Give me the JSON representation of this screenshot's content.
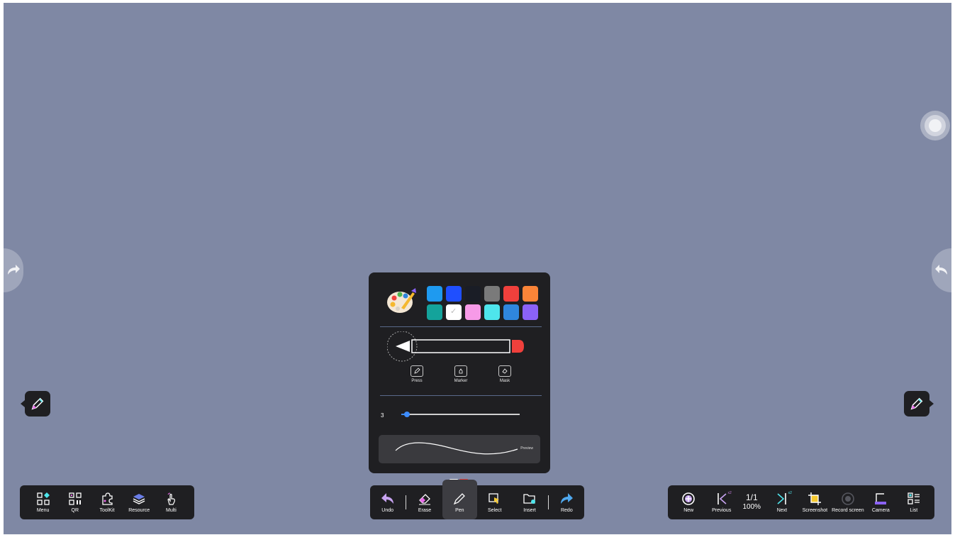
{
  "left_toolbar": [
    {
      "label": "Menu",
      "icon": "menu-grid-icon"
    },
    {
      "label": "QR",
      "icon": "qr-code-icon"
    },
    {
      "label": "ToolKit",
      "icon": "puzzle-icon"
    },
    {
      "label": "Resource",
      "icon": "layers-icon"
    },
    {
      "label": "Multi",
      "icon": "multi-touch-icon"
    }
  ],
  "center_toolbar": {
    "undo": "Undo",
    "erase": "Erase",
    "pen": "Pen",
    "select": "Select",
    "insert": "Insert",
    "redo": "Redo",
    "active": "Pen"
  },
  "right_toolbar": {
    "new": "New",
    "previous": "Previous",
    "previous_badge": "x2",
    "page": "1/1",
    "zoom": "100%",
    "next": "Next",
    "next_badge": "x2",
    "screenshot": "Screenshot",
    "record": "Record screen",
    "camera": "Camera",
    "list": "List"
  },
  "pen_panel": {
    "colors": [
      "#1e9af0",
      "#1f4fff",
      "#1a1d26",
      "#7a7a7a",
      "#f0403c",
      "#fa8438",
      "#14a39b",
      "#ffffff",
      "#f79ae8",
      "#4ee5ec",
      "#2f86de",
      "#8b62f7"
    ],
    "selected_color_index": 7,
    "pen_types": [
      "Pressure",
      "Marker",
      "Mask"
    ],
    "pen_type_visible_labels": [
      "Press",
      "Marker",
      "Mask"
    ],
    "size_value": "3",
    "size_fraction": 0.05,
    "preview_label": "Preview"
  },
  "accent_colors": {
    "canvas": "#7f88a4",
    "toolbar": "#1f1f22",
    "active_tool": "#3d3d42",
    "slider": "#3d8cff",
    "page_dot_inactive": "#ffffff",
    "page_dot_active": "#e04040"
  }
}
